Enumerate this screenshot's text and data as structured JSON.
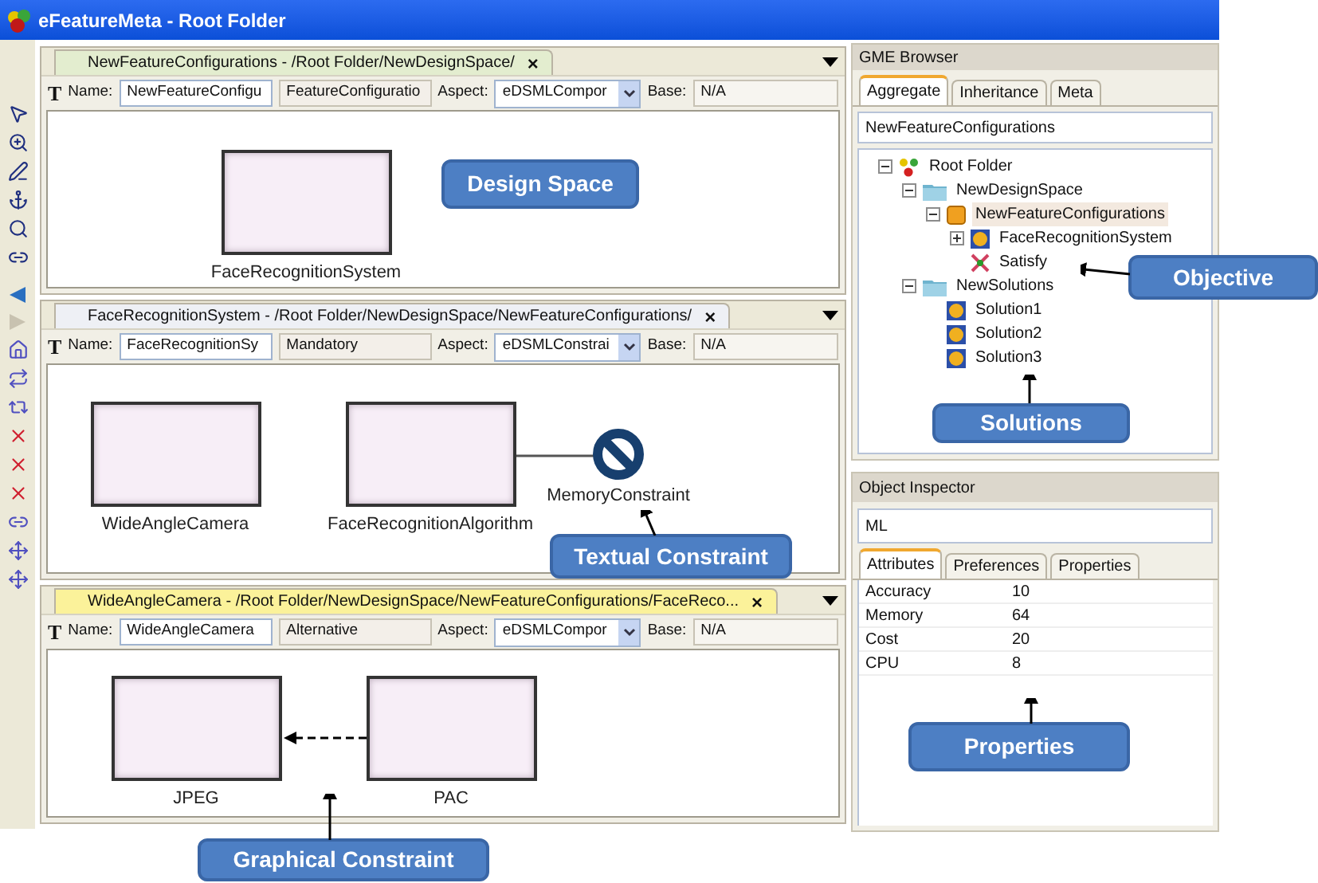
{
  "window": {
    "title": "eFeatureMeta - Root Folder"
  },
  "editors": [
    {
      "tab_title": "NewFeatureConfigurations - /Root Folder/NewDesignSpace/",
      "close": "×",
      "color": "#e3edcf",
      "text_tool": "T",
      "name_label": "Name:",
      "name": "NewFeatureConfigu",
      "type": "FeatureConfiguratio",
      "aspect_label": "Aspect:",
      "aspect": "eDSMLCompor",
      "base_label": "Base:",
      "base": "N/A",
      "nodes": [
        {
          "label": "FaceRecognitionSystem",
          "kind": "model"
        }
      ]
    },
    {
      "tab_title": "FaceRecognitionSystem - /Root Folder/NewDesignSpace/NewFeatureConfigurations/",
      "close": "×",
      "color": "#eef0f5",
      "text_tool": "T",
      "name_label": "Name:",
      "name": "FaceRecognitionSy",
      "type": "Mandatory",
      "aspect_label": "Aspect:",
      "aspect": "eDSMLConstrai",
      "base_label": "Base:",
      "base": "N/A",
      "connections": [
        {
          "kind": "line"
        }
      ],
      "nodes": [
        {
          "label": "WideAngleCamera",
          "kind": "model"
        },
        {
          "label": "FaceRecognitionAlgorithm",
          "kind": "model"
        },
        {
          "label": "MemoryConstraint",
          "kind": "constraint"
        }
      ]
    },
    {
      "tab_title": "WideAngleCamera - /Root Folder/NewDesignSpace/NewFeatureConfigurations/FaceReco...",
      "close": "×",
      "color": "#fbf29a",
      "text_tool": "T",
      "name_label": "Name:",
      "name": "WideAngleCamera",
      "type": "Alternative",
      "aspect_label": "Aspect:",
      "aspect": "eDSMLCompor",
      "base_label": "Base:",
      "base": "N/A",
      "connections": [
        {
          "kind": "dashed-arrow"
        }
      ],
      "nodes": [
        {
          "label": "JPEG",
          "kind": "model"
        },
        {
          "label": "PAC",
          "kind": "model"
        }
      ]
    }
  ],
  "browser": {
    "title": "GME Browser",
    "tabs": [
      {
        "label": "Aggregate",
        "selected": true
      },
      {
        "label": "Inheritance",
        "selected": false
      },
      {
        "label": "Meta",
        "selected": false
      }
    ],
    "field": "NewFeatureConfigurations",
    "tree": [
      {
        "label": "Root Folder",
        "kind": "root",
        "expanded": true,
        "selected": false,
        "children": [
          {
            "label": "NewDesignSpace",
            "kind": "folder",
            "expanded": true,
            "selected": false,
            "children": [
              {
                "label": "NewFeatureConfigurations",
                "kind": "feature",
                "expanded": true,
                "selected": true,
                "children": [
                  {
                    "label": "FaceRecognitionSystem",
                    "kind": "model",
                    "expanded": false,
                    "selected": false
                  },
                  {
                    "label": "Satisfy",
                    "kind": "objective",
                    "selected": false
                  }
                ]
              }
            ]
          },
          {
            "label": "NewSolutions",
            "kind": "folder",
            "expanded": true,
            "selected": false,
            "children": [
              {
                "label": "Solution1",
                "kind": "model",
                "selected": false
              },
              {
                "label": "Solution2",
                "kind": "model",
                "selected": false
              },
              {
                "label": "Solution3",
                "kind": "model",
                "selected": false
              }
            ]
          }
        ]
      }
    ]
  },
  "inspector": {
    "title": "Object Inspector",
    "field": "ML",
    "tabs": [
      {
        "label": "Attributes",
        "selected": true
      },
      {
        "label": "Preferences",
        "selected": false
      },
      {
        "label": "Properties",
        "selected": false
      }
    ],
    "attributes": [
      {
        "name": "Accuracy",
        "value": "10"
      },
      {
        "name": "Memory",
        "value": "64"
      },
      {
        "name": "Cost",
        "value": "20"
      },
      {
        "name": "CPU",
        "value": "8"
      }
    ]
  },
  "callouts": [
    {
      "label": "Design Space"
    },
    {
      "label": "Textual Constraint"
    },
    {
      "label": "Graphical Constraint"
    },
    {
      "label": "Objective"
    },
    {
      "label": "Solutions"
    },
    {
      "label": "Properties"
    }
  ]
}
